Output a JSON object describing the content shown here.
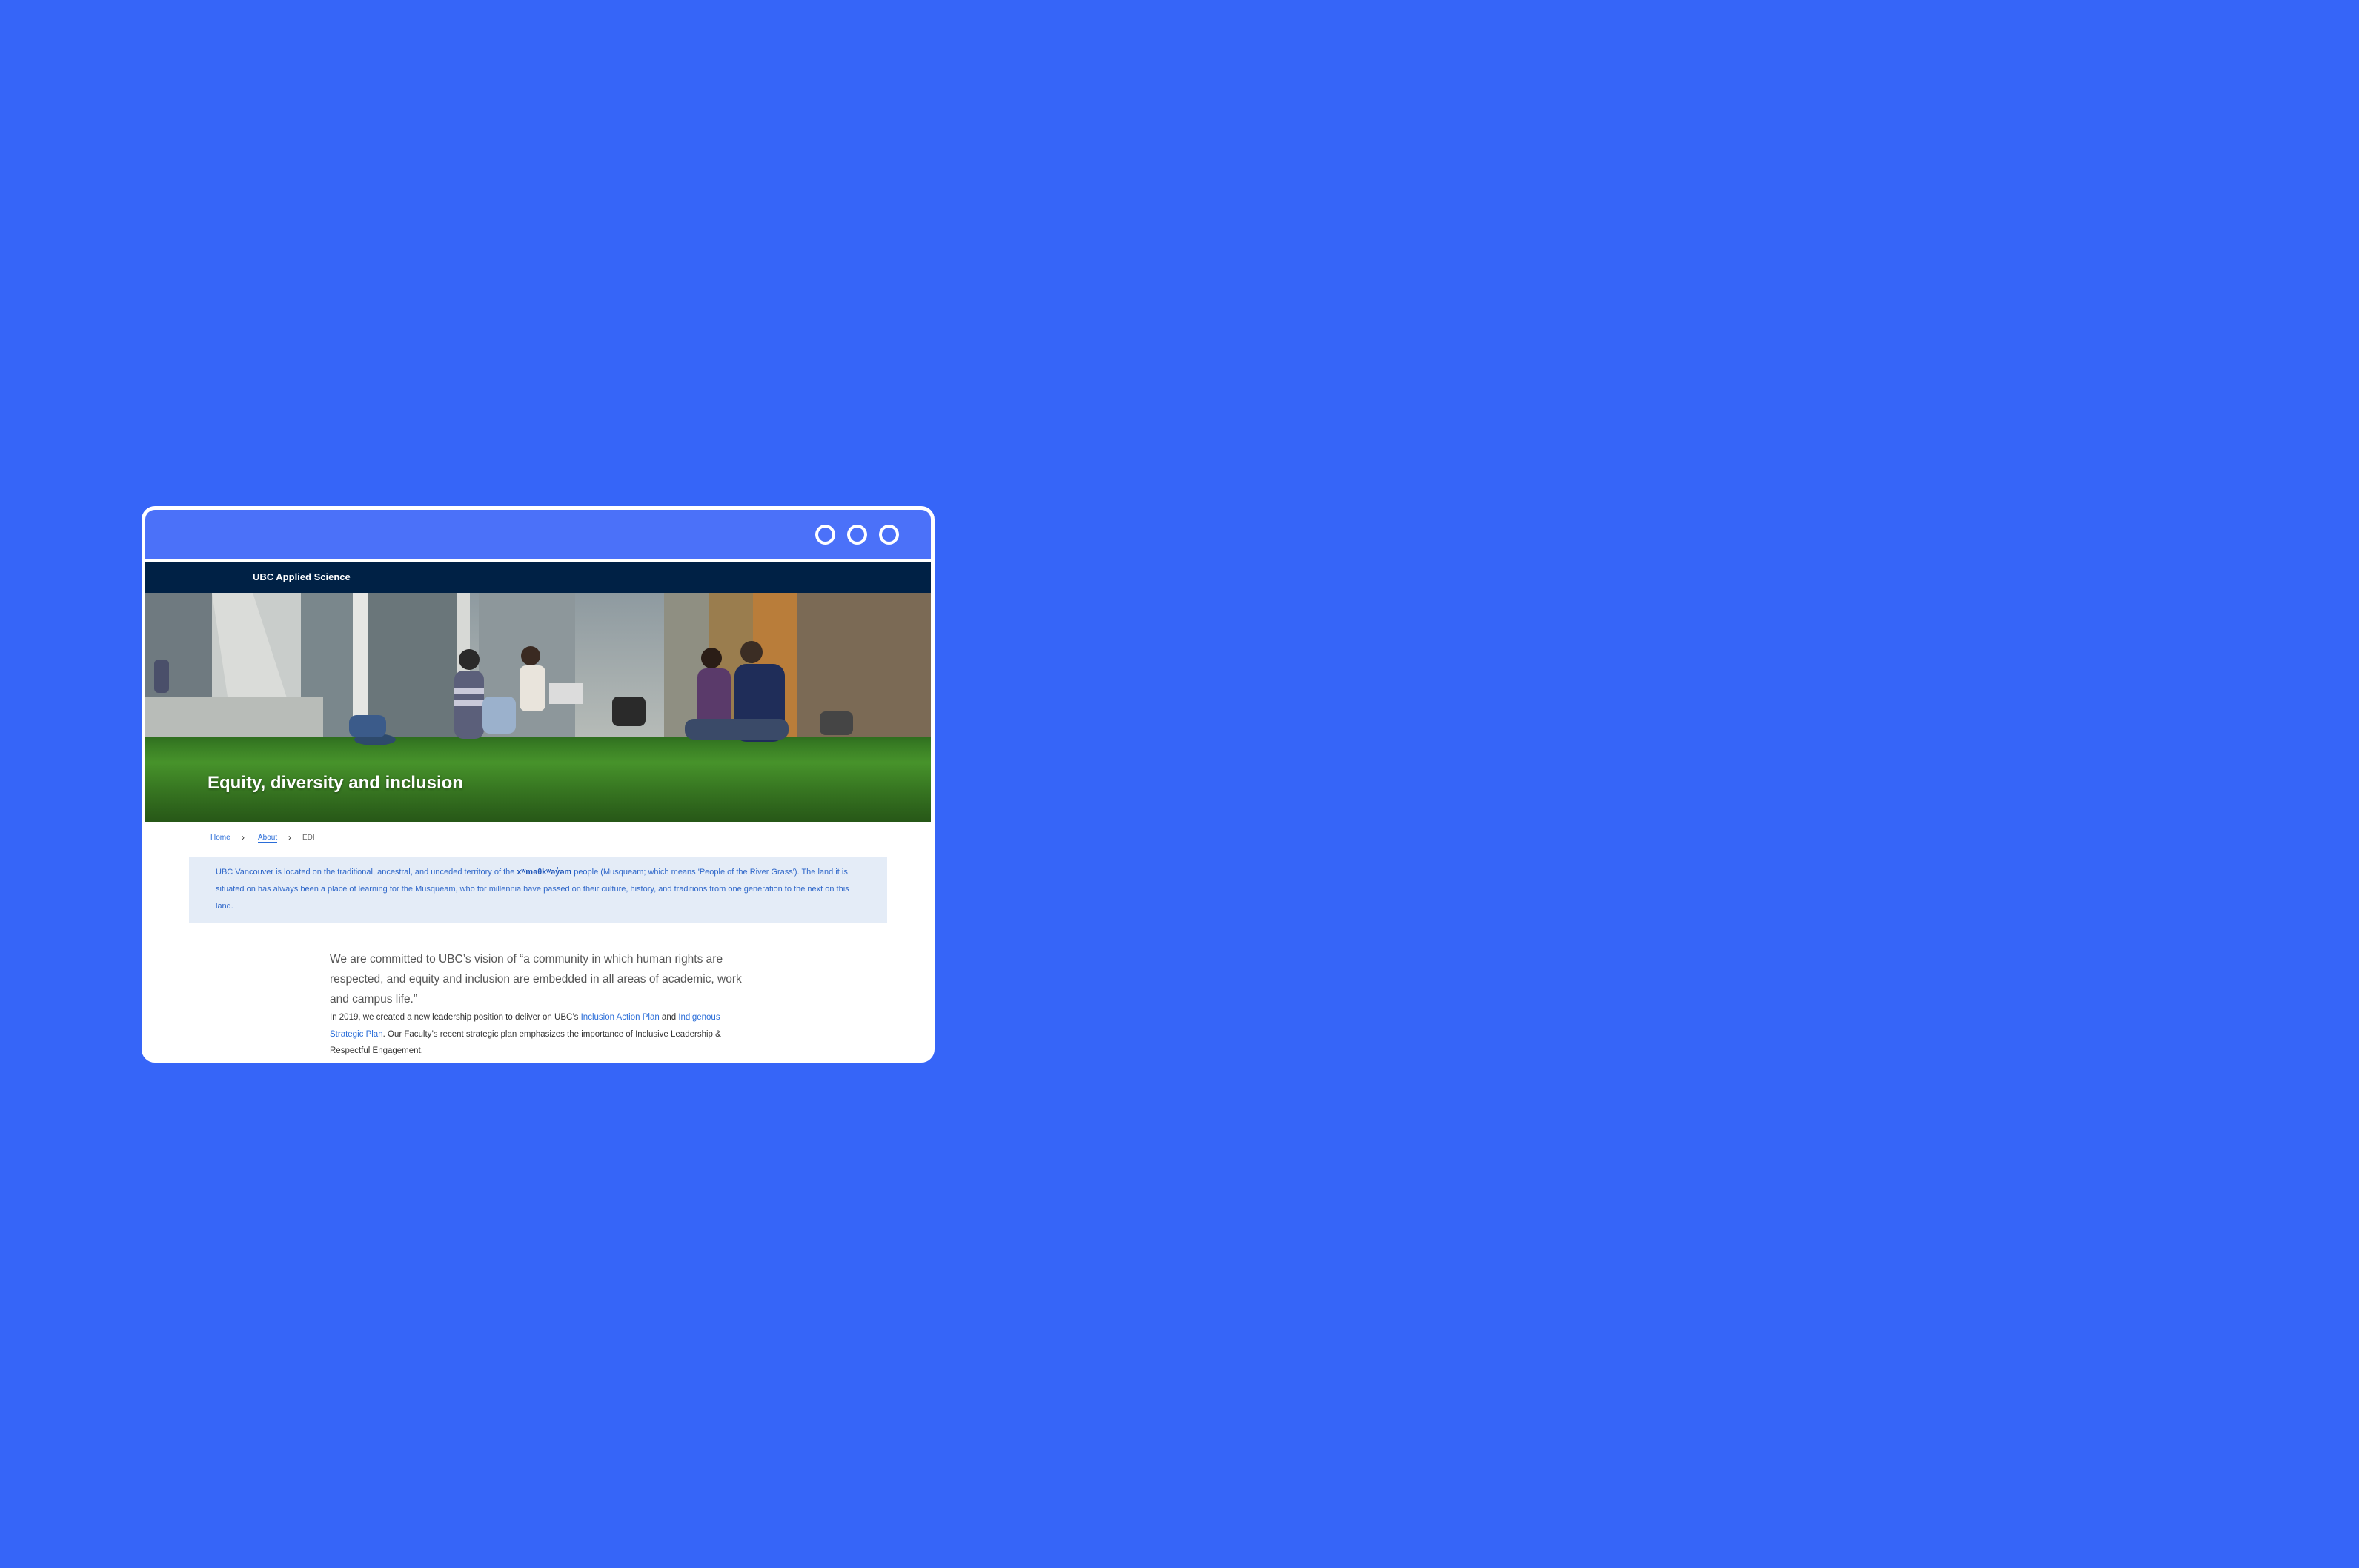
{
  "window": {
    "controls": [
      "circle",
      "circle",
      "circle"
    ]
  },
  "header": {
    "brand": "UBC Applied Science"
  },
  "hero": {
    "title": "Equity, diversity and inclusion"
  },
  "breadcrumb": {
    "items": [
      "Home",
      "About",
      "EDI"
    ]
  },
  "acknowledgement": {
    "text_before": "UBC Vancouver is located on the traditional, ancestral, and unceded territory of the ",
    "nation": "xʷməθkʷəy̓əm",
    "text_after": " people (Musqueam; which means 'People of the River Grass'). The land it is situated on has always been a place of learning for the Musqueam, who for millennia have passed on their culture, history, and traditions from one generation to the next on this land."
  },
  "main": {
    "quote": "We are committed to UBC’s vision of “a community in which human rights are respected, and equity and inclusion are embedded in all areas of academic, work and campus life.”",
    "para_1": "In 2019, we created a new leadership position to deliver on UBC’s ",
    "link_1": "Inclusion Action Plan",
    "para_2": " and ",
    "link_2": "Indigenous Strategic Plan",
    "para_3": ". Our Faculty’s recent strategic plan emphasizes the importance of Inclusive Leadership & Respectful Engagement."
  },
  "colors": {
    "background": "#3665f8",
    "titlebar": "#4b71f9",
    "header": "#002145",
    "link": "#2a6dd8",
    "ack_bg": "#e4ecf7"
  }
}
